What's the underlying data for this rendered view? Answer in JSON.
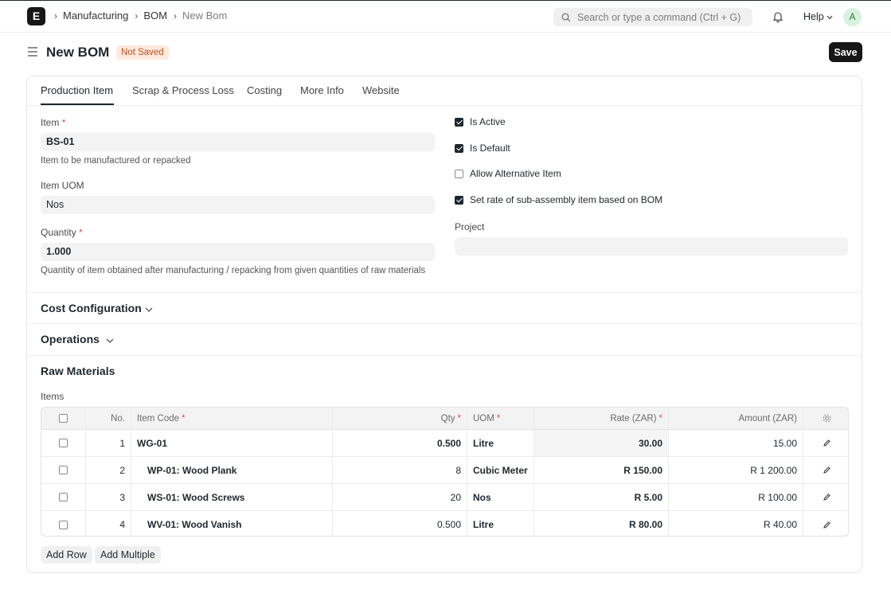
{
  "navbar": {
    "logo": "E",
    "breadcrumbs": [
      "Manufacturing",
      "BOM",
      "New Bom"
    ],
    "search_placeholder": "Search or type a command (Ctrl + G)",
    "help_label": "Help",
    "avatar_initial": "A"
  },
  "page": {
    "title": "New BOM",
    "status": "Not Saved",
    "save_label": "Save"
  },
  "tabs": [
    "Production Item",
    "Scrap & Process Loss",
    "Costing",
    "More Info",
    "Website"
  ],
  "form": {
    "item": {
      "label": "Item",
      "value": "BS-01",
      "help": "Item to be manufactured or repacked"
    },
    "uom": {
      "label": "Item UOM",
      "value": "Nos"
    },
    "quantity": {
      "label": "Quantity",
      "value": "1.000",
      "help": "Quantity of item obtained after manufacturing / repacking from given quantities of raw materials"
    },
    "checks": [
      {
        "label": "Is Active",
        "checked": true
      },
      {
        "label": "Is Default",
        "checked": true
      },
      {
        "label": "Allow Alternative Item",
        "checked": false
      },
      {
        "label": "Set rate of sub-assembly item based on BOM",
        "checked": true
      }
    ],
    "project": {
      "label": "Project",
      "value": ""
    }
  },
  "sections": {
    "cost_configuration": "Cost Configuration",
    "operations": "Operations",
    "raw_materials": "Raw Materials",
    "items_label": "Items"
  },
  "table": {
    "headers": {
      "no": "No.",
      "item_code": "Item Code",
      "qty": "Qty",
      "uom": "UOM",
      "rate": "Rate (ZAR)",
      "amount": "Amount (ZAR)"
    },
    "rows": [
      {
        "no": "1",
        "item_code": "WG-01",
        "qty": "0.500",
        "uom": "Litre",
        "rate": "30.00",
        "amount": "15.00"
      },
      {
        "no": "2",
        "item_code": "WP-01: Wood Plank",
        "qty": "8",
        "uom": "Cubic Meter",
        "rate": "R 150.00",
        "amount": "R 1 200.00"
      },
      {
        "no": "3",
        "item_code": "WS-01: Wood Screws",
        "qty": "20",
        "uom": "Nos",
        "rate": "R 5.00",
        "amount": "R 100.00"
      },
      {
        "no": "4",
        "item_code": "WV-01: Wood Vanish",
        "qty": "0.500",
        "uom": "Litre",
        "rate": "R 80.00",
        "amount": "R 40.00"
      }
    ],
    "add_row": "Add Row",
    "add_multiple": "Add Multiple"
  }
}
